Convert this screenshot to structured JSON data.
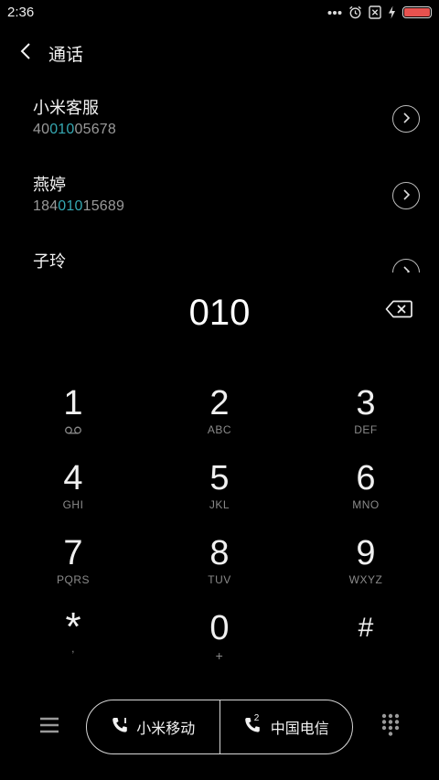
{
  "status_bar": {
    "time": "2:36",
    "icons": [
      "more-dots-icon",
      "alarm-icon",
      "no-sim-icon",
      "charging-icon",
      "battery-icon"
    ],
    "battery_color": "#e8524f"
  },
  "header": {
    "title": "通话"
  },
  "contacts": [
    {
      "name": "小米客服",
      "number_pre": "40",
      "number_match": "010",
      "number_post": "05678"
    },
    {
      "name": "燕婷",
      "number_pre": "184",
      "number_match": "010",
      "number_post": "15689"
    },
    {
      "name": "子玲",
      "number_pre": "",
      "number_match": "",
      "number_post": ""
    }
  ],
  "highlight_color": "#35a8b2",
  "dial": {
    "number": "010"
  },
  "keypad": [
    {
      "digit": "1",
      "letters": "",
      "sub_icon": "voicemail-icon"
    },
    {
      "digit": "2",
      "letters": "ABC"
    },
    {
      "digit": "3",
      "letters": "DEF"
    },
    {
      "digit": "4",
      "letters": "GHI"
    },
    {
      "digit": "5",
      "letters": "JKL"
    },
    {
      "digit": "6",
      "letters": "MNO"
    },
    {
      "digit": "7",
      "letters": "PQRS"
    },
    {
      "digit": "8",
      "letters": "TUV"
    },
    {
      "digit": "9",
      "letters": "WXYZ"
    },
    {
      "digit": "*",
      "letters": ","
    },
    {
      "digit": "0",
      "letters": "+"
    },
    {
      "digit": "#",
      "letters": ""
    }
  ],
  "bottom_bar": {
    "sim1_label": "小米移动",
    "sim2_label": "中国电信",
    "sim2_badge": "2"
  }
}
